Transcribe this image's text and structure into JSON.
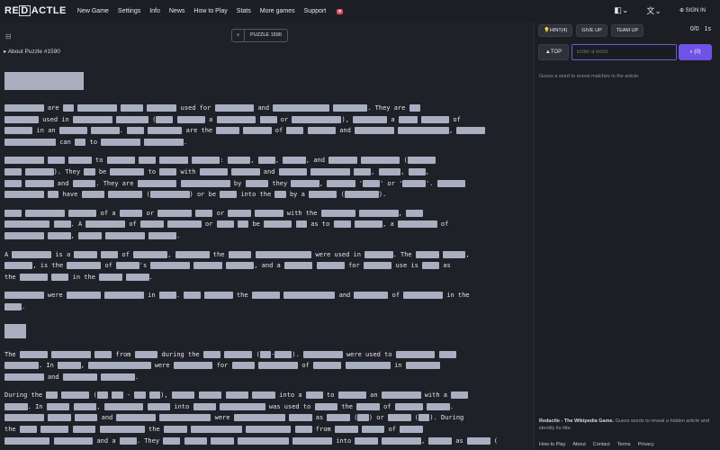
{
  "nav": {
    "logo_prefix": "RE",
    "logo_box": "D",
    "logo_suffix": "ACTLE",
    "links": [
      "New Game",
      "Settings",
      "Info",
      "News",
      "How to Play",
      "Stats",
      "More games",
      "Support"
    ],
    "support_badge": "♥",
    "sign_in": "SIGN IN"
  },
  "main": {
    "puzzle_label": "PUZZLE 1590",
    "back_label": "«",
    "about": "About Puzzle #1590",
    "heading_num": "7"
  },
  "sidebar": {
    "hint_label": "HINT(4)",
    "give_up_label": "GIVE UP",
    "team_up_label": "TEAM UP",
    "score": "0/0",
    "time": "1s",
    "top_label": "▲TOP",
    "search_placeholder": "Enter a word",
    "search_btn_label": "(0)",
    "hint_text": "Guess a word to reveal matches in the article.",
    "footer_title": "Redactle - The Wikipedia Game.",
    "footer_desc": "Guess words to reveal a hidden article and identify its title.",
    "footer_links": [
      "How to Play",
      "About",
      "Contact",
      "Terms",
      "Privacy"
    ]
  },
  "article": {
    "p1": [
      [
        [
          "r",
          46
        ],
        " are ",
        [
          "r",
          13
        ],
        " ",
        [
          "r",
          46
        ],
        " ",
        [
          "r",
          26
        ],
        " ",
        [
          "r",
          35
        ],
        " used for ",
        [
          "r",
          46
        ],
        " and ",
        [
          "r",
          66
        ],
        " ",
        [
          "r",
          40
        ],
        ". They are ",
        [
          "r",
          13
        ]
      ],
      [
        [
          "r",
          40
        ],
        " used in ",
        [
          "r",
          46
        ],
        " ",
        [
          "r",
          38
        ],
        " (",
        [
          "r",
          20
        ],
        " ",
        [
          "r",
          33
        ],
        " a ",
        [
          "r",
          46
        ],
        " ",
        [
          "r",
          20
        ],
        " or ",
        [
          "r",
          58
        ],
        "), ",
        [
          "r",
          40
        ],
        " a ",
        [
          "r",
          22
        ],
        " ",
        [
          "r",
          33
        ],
        " of"
      ],
      [
        [
          "r",
          33
        ],
        " in an ",
        [
          "r",
          33
        ],
        " ",
        [
          "r",
          33
        ],
        ". ",
        [
          "r",
          20
        ],
        " ",
        [
          "r",
          40
        ],
        " are the ",
        [
          "r",
          27
        ],
        " ",
        [
          "r",
          33
        ],
        " of ",
        [
          "r",
          20
        ],
        " ",
        [
          "r",
          33
        ],
        " and ",
        [
          "r",
          46
        ],
        " ",
        [
          "r",
          60
        ],
        ", ",
        [
          "r",
          33
        ]
      ],
      [
        [
          "r",
          60
        ],
        " can ",
        [
          "r",
          13
        ],
        " to ",
        [
          "r",
          46
        ],
        " ",
        [
          "r",
          46
        ],
        "."
      ]
    ],
    "p2": [
      [
        [
          "r",
          46
        ],
        " ",
        [
          "r",
          20
        ],
        " ",
        [
          "r",
          27
        ],
        " to ",
        [
          "r",
          33
        ],
        " ",
        [
          "r",
          20
        ],
        " ",
        [
          "r",
          33
        ],
        " ",
        [
          "r",
          33
        ],
        ": ",
        [
          "r",
          27
        ],
        ", ",
        [
          "r",
          20
        ],
        ", ",
        [
          "r",
          27
        ],
        ", and ",
        [
          "r",
          33
        ],
        " ",
        [
          "r",
          46
        ],
        " (",
        [
          "r",
          33
        ]
      ],
      [
        [
          "r",
          20
        ],
        " ",
        [
          "r",
          33
        ],
        "). They ",
        [
          "r",
          13
        ],
        " be ",
        [
          "r",
          40
        ],
        " to ",
        [
          "r",
          20
        ],
        " with ",
        [
          "r",
          33
        ],
        " ",
        [
          "r",
          33
        ],
        " and ",
        [
          "r",
          33
        ],
        " ",
        [
          "r",
          46
        ],
        " ",
        [
          "r",
          20
        ],
        ", ",
        [
          "r",
          26
        ],
        ", ",
        [
          "r",
          20
        ],
        ","
      ],
      [
        [
          "r",
          20
        ],
        " ",
        [
          "r",
          33
        ],
        " and ",
        [
          "r",
          27
        ],
        ". They are ",
        [
          "r",
          46
        ],
        " ",
        [
          "r",
          58
        ],
        " by ",
        [
          "r",
          27
        ],
        " they ",
        [
          "r",
          33
        ],
        ", ",
        [
          "r",
          33
        ],
        " '",
        [
          "r",
          20
        ],
        "' or '",
        [
          "r",
          27
        ],
        "'. ",
        [
          "r",
          33
        ]
      ],
      [
        [
          "r",
          46
        ],
        " ",
        [
          "r",
          13
        ],
        " have ",
        [
          "r",
          27
        ],
        " ",
        [
          "r",
          40
        ],
        " (",
        [
          "r",
          46
        ],
        ") or be ",
        [
          "r",
          20
        ],
        " into the ",
        [
          "r",
          13
        ],
        " by a ",
        [
          "r",
          33
        ],
        " (",
        [
          "r",
          40
        ],
        ")."
      ]
    ],
    "p3": [
      [
        [
          "r",
          20
        ],
        " ",
        [
          "r",
          46
        ],
        " ",
        [
          "r",
          33
        ],
        " of a ",
        [
          "r",
          27
        ],
        " or ",
        [
          "r",
          40
        ],
        " ",
        [
          "r",
          20
        ],
        " or ",
        [
          "r",
          27
        ],
        " ",
        [
          "r",
          33
        ],
        " with the ",
        [
          "r",
          40
        ],
        " ",
        [
          "r",
          46
        ],
        ", ",
        [
          "r",
          20
        ]
      ],
      [
        [
          "r",
          53
        ],
        " ",
        [
          "r",
          20
        ],
        ". A ",
        [
          "r",
          46
        ],
        " of ",
        [
          "r",
          27
        ],
        " ",
        [
          "r",
          40
        ],
        " or ",
        [
          "r",
          20
        ],
        " ",
        [
          "r",
          13
        ],
        " be ",
        [
          "r",
          33
        ],
        " ",
        [
          "r",
          13
        ],
        " as to ",
        [
          "r",
          20
        ],
        " ",
        [
          "r",
          33
        ],
        ", a ",
        [
          "r",
          46
        ],
        " of"
      ],
      [
        [
          "r",
          46
        ],
        " ",
        [
          "r",
          27
        ],
        ", ",
        [
          "r",
          27
        ],
        " ",
        [
          "r",
          46
        ],
        " ",
        [
          "r",
          33
        ],
        "."
      ]
    ],
    "p4": [
      [
        "A ",
        [
          "r",
          46
        ],
        " is a ",
        [
          "r",
          27
        ],
        " ",
        [
          "r",
          20
        ],
        " of ",
        [
          "r",
          40
        ],
        ", ",
        [
          "r",
          40
        ],
        " the ",
        [
          "r",
          27
        ],
        " ",
        [
          "r",
          66
        ],
        " were used in ",
        [
          "r",
          33
        ],
        ". The ",
        [
          "r",
          27
        ],
        " ",
        [
          "r",
          27
        ],
        ","
      ],
      [
        [
          "r",
          33
        ],
        ", is the ",
        [
          "r",
          40
        ],
        " of ",
        [
          "r",
          27
        ],
        "'s ",
        [
          "r",
          46
        ],
        " ",
        [
          "r",
          33
        ],
        " ",
        [
          "r",
          33
        ],
        ", and a ",
        [
          "r",
          33
        ],
        " ",
        [
          "r",
          33
        ],
        " for ",
        [
          "r",
          33
        ],
        " use is ",
        [
          "r",
          20
        ],
        " as"
      ],
      [
        "the ",
        [
          "r",
          33
        ],
        " ",
        [
          "r",
          20
        ],
        " in the ",
        [
          "r",
          27
        ],
        " ",
        [
          "r",
          27
        ],
        "."
      ]
    ],
    "p5": [
      [
        [
          "r",
          46
        ],
        " were ",
        [
          "r",
          40
        ],
        " ",
        [
          "r",
          46
        ],
        " in ",
        [
          "r",
          20
        ],
        ". ",
        [
          "r",
          20
        ],
        " ",
        [
          "r",
          33
        ],
        " the ",
        [
          "r",
          33
        ],
        " ",
        [
          "r",
          60
        ],
        " and ",
        [
          "r",
          40
        ],
        " of ",
        [
          "r",
          46
        ],
        " in the"
      ],
      [
        [
          "r",
          20
        ],
        "."
      ]
    ],
    "p6": [
      [
        "The ",
        [
          "r",
          33
        ],
        " ",
        [
          "r",
          46
        ],
        " ",
        [
          "r",
          20
        ],
        " from ",
        [
          "r",
          27
        ],
        " during the ",
        [
          "r",
          20
        ],
        " ",
        [
          "r",
          33
        ],
        " (",
        [
          "r",
          13
        ],
        "-",
        [
          "r",
          20
        ],
        "). ",
        [
          "r",
          46
        ],
        " were used to ",
        [
          "r",
          46
        ],
        " ",
        [
          "r",
          20
        ]
      ],
      [
        [
          "r",
          40
        ],
        ". In ",
        [
          "r",
          27
        ],
        ", ",
        [
          "r",
          73
        ],
        " were ",
        [
          "r",
          46
        ],
        " for ",
        [
          "r",
          27
        ],
        " ",
        [
          "r",
          46
        ],
        " of ",
        [
          "r",
          33
        ],
        " ",
        [
          "r",
          53
        ],
        " in ",
        [
          "r",
          40
        ]
      ],
      [
        [
          "r",
          46
        ],
        " and ",
        [
          "r",
          40
        ],
        " ",
        [
          "r",
          40
        ],
        "."
      ]
    ],
    "p7": [
      [
        "During the ",
        [
          "r",
          13
        ],
        " ",
        [
          "r",
          33
        ],
        " (",
        [
          "r",
          13
        ],
        " ",
        [
          "r",
          13
        ],
        " - ",
        [
          "r",
          13
        ],
        " ",
        [
          "r",
          13
        ],
        "), ",
        [
          "r",
          27
        ],
        " ",
        [
          "r",
          27
        ],
        " ",
        [
          "r",
          27
        ],
        " ",
        [
          "r",
          27
        ],
        " into a ",
        [
          "r",
          20
        ],
        " to ",
        [
          "r",
          33
        ],
        " an ",
        [
          "r",
          46
        ],
        " with a ",
        [
          "r",
          20
        ]
      ],
      [
        [
          "r",
          27
        ],
        ". In ",
        [
          "r",
          27
        ],
        " ",
        [
          "r",
          27
        ],
        ", ",
        [
          "r",
          46
        ],
        " ",
        [
          "r",
          27
        ],
        " into ",
        [
          "r",
          27
        ],
        " ",
        [
          "r",
          53
        ],
        " was used to ",
        [
          "r",
          27
        ],
        " the ",
        [
          "r",
          27
        ],
        " of ",
        [
          "r",
          33
        ],
        " ",
        [
          "r",
          27
        ],
        "."
      ],
      [
        [
          "r",
          46
        ],
        " ",
        [
          "r",
          27
        ],
        " ",
        [
          "r",
          27
        ],
        " and ",
        [
          "r",
          46
        ],
        " ",
        [
          "r",
          60
        ],
        " were ",
        [
          "r",
          60
        ],
        " ",
        [
          "r",
          27
        ],
        " as ",
        [
          "r",
          27
        ],
        " (",
        [
          "r",
          13
        ],
        ") or ",
        [
          "r",
          27
        ],
        " (",
        [
          "r",
          13
        ],
        "). During"
      ],
      [
        "the ",
        [
          "r",
          20
        ],
        " ",
        [
          "r",
          33
        ],
        " ",
        [
          "r",
          27
        ],
        " ",
        [
          "r",
          53
        ],
        " the ",
        [
          "r",
          27
        ],
        " ",
        [
          "r",
          60
        ],
        " ",
        [
          "r",
          53
        ],
        " ",
        [
          "r",
          20
        ],
        " from ",
        [
          "r",
          27
        ],
        " ",
        [
          "r",
          27
        ],
        " of ",
        [
          "r",
          27
        ]
      ],
      [
        [
          "r",
          53
        ],
        " ",
        [
          "r",
          46
        ],
        " and a ",
        [
          "r",
          20
        ],
        ". They ",
        [
          "r",
          20
        ],
        " ",
        [
          "r",
          27
        ],
        " ",
        [
          "r",
          27
        ],
        " ",
        [
          "r",
          60
        ],
        " ",
        [
          "r",
          46
        ],
        " into ",
        [
          "r",
          27
        ],
        " ",
        [
          "r",
          46
        ],
        ", ",
        [
          "r",
          27
        ],
        " as ",
        [
          "r",
          27
        ],
        " ("
      ]
    ]
  }
}
